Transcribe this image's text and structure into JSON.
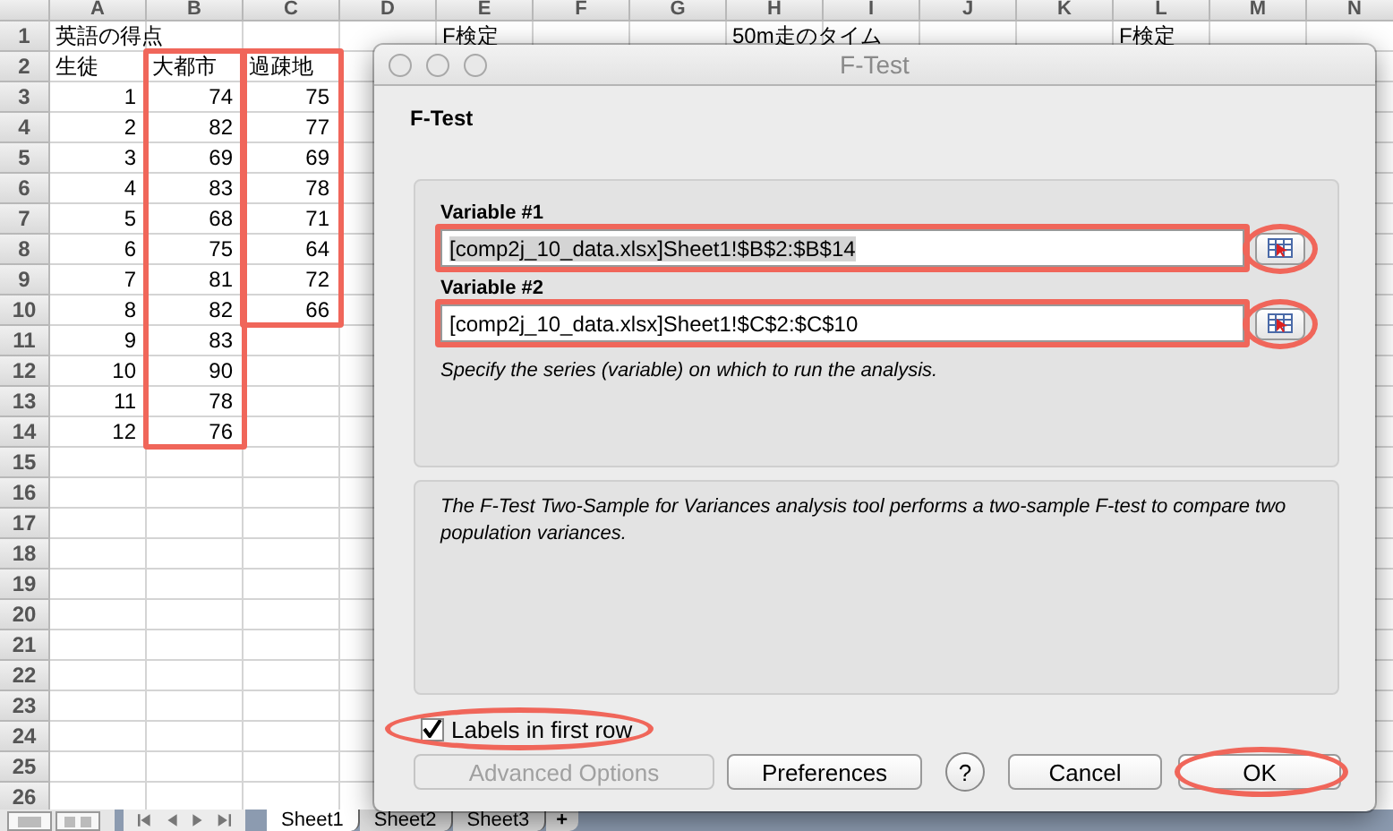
{
  "sheet": {
    "columns": [
      {
        "label": "A",
        "highlighted": false
      },
      {
        "label": "B",
        "highlighted": true
      },
      {
        "label": "C",
        "highlighted": true
      },
      {
        "label": "D",
        "highlighted": false
      },
      {
        "label": "E",
        "highlighted": false
      },
      {
        "label": "F",
        "highlighted": false
      },
      {
        "label": "G",
        "highlighted": false
      },
      {
        "label": "H",
        "highlighted": false
      },
      {
        "label": "I",
        "highlighted": false
      },
      {
        "label": "J",
        "highlighted": false
      },
      {
        "label": "K",
        "highlighted": false
      },
      {
        "label": "L",
        "highlighted": false
      },
      {
        "label": "M",
        "highlighted": false
      },
      {
        "label": "N",
        "highlighted": false
      }
    ],
    "rows": [
      {
        "number": "1",
        "cells": [
          {
            "text": "英語の得点",
            "kind": "text"
          },
          null,
          null,
          null,
          {
            "text": "F検定",
            "kind": "text"
          },
          null,
          null,
          {
            "text": "50m走のタイム",
            "kind": "text"
          },
          null,
          null,
          null,
          {
            "text": "F検定",
            "kind": "text"
          }
        ]
      },
      {
        "number": "2",
        "cells": [
          {
            "text": "生徒",
            "kind": "text"
          },
          {
            "text": "大都市",
            "kind": "text"
          },
          {
            "text": "過疎地",
            "kind": "text"
          }
        ]
      },
      {
        "number": "3",
        "cells": [
          {
            "text": "1",
            "kind": "number"
          },
          {
            "text": "74",
            "kind": "number"
          },
          {
            "text": "75",
            "kind": "number"
          }
        ]
      },
      {
        "number": "4",
        "cells": [
          {
            "text": "2",
            "kind": "number"
          },
          {
            "text": "82",
            "kind": "number"
          },
          {
            "text": "77",
            "kind": "number"
          }
        ]
      },
      {
        "number": "5",
        "cells": [
          {
            "text": "3",
            "kind": "number"
          },
          {
            "text": "69",
            "kind": "number"
          },
          {
            "text": "69",
            "kind": "number"
          }
        ]
      },
      {
        "number": "6",
        "cells": [
          {
            "text": "4",
            "kind": "number"
          },
          {
            "text": "83",
            "kind": "number"
          },
          {
            "text": "78",
            "kind": "number"
          }
        ]
      },
      {
        "number": "7",
        "cells": [
          {
            "text": "5",
            "kind": "number"
          },
          {
            "text": "68",
            "kind": "number"
          },
          {
            "text": "71",
            "kind": "number"
          }
        ]
      },
      {
        "number": "8",
        "cells": [
          {
            "text": "6",
            "kind": "number"
          },
          {
            "text": "75",
            "kind": "number"
          },
          {
            "text": "64",
            "kind": "number"
          }
        ]
      },
      {
        "number": "9",
        "cells": [
          {
            "text": "7",
            "kind": "number"
          },
          {
            "text": "81",
            "kind": "number"
          },
          {
            "text": "72",
            "kind": "number"
          }
        ]
      },
      {
        "number": "10",
        "cells": [
          {
            "text": "8",
            "kind": "number"
          },
          {
            "text": "82",
            "kind": "number"
          },
          {
            "text": "66",
            "kind": "number"
          }
        ]
      },
      {
        "number": "11",
        "cells": [
          {
            "text": "9",
            "kind": "number"
          },
          {
            "text": "83",
            "kind": "number"
          }
        ]
      },
      {
        "number": "12",
        "cells": [
          {
            "text": "10",
            "kind": "number"
          },
          {
            "text": "90",
            "kind": "number"
          }
        ]
      },
      {
        "number": "13",
        "cells": [
          {
            "text": "11",
            "kind": "number"
          },
          {
            "text": "78",
            "kind": "number"
          }
        ]
      },
      {
        "number": "14",
        "cells": [
          {
            "text": "12",
            "kind": "number"
          },
          {
            "text": "76",
            "kind": "number"
          }
        ]
      },
      {
        "number": "15"
      },
      {
        "number": "16"
      },
      {
        "number": "17"
      },
      {
        "number": "18"
      },
      {
        "number": "19"
      },
      {
        "number": "20"
      },
      {
        "number": "21"
      },
      {
        "number": "22"
      },
      {
        "number": "23"
      },
      {
        "number": "24"
      },
      {
        "number": "25"
      },
      {
        "number": "26"
      }
    ]
  },
  "sheet_tabs": [
    {
      "label": "Sheet1",
      "selected": true
    },
    {
      "label": "Sheet2",
      "selected": false
    },
    {
      "label": "Sheet3",
      "selected": false
    }
  ],
  "add_sheet": "+",
  "dialog": {
    "title": "F-Test",
    "heading": "F-Test",
    "variables": [
      {
        "label": "Variable #1",
        "value": "[comp2j_10_data.xlsx]Sheet1!$B$2:$B$14",
        "text_selected": true,
        "highlighted": true
      },
      {
        "label": "Variable #2",
        "value": "[comp2j_10_data.xlsx]Sheet1!$C$2:$C$10",
        "text_selected": false,
        "highlighted": true
      }
    ],
    "hint": "Specify the series (variable) on which to run the analysis.",
    "description": "The F-Test Two-Sample for Variances analysis tool performs a two-sample F-test to compare two population variances.",
    "checkbox": {
      "label": "Labels in first row",
      "checked": true,
      "highlighted": true
    },
    "buttons": [
      {
        "label": "Advanced Options",
        "kind": "push",
        "disabled": true,
        "highlighted": false
      },
      {
        "label": "Preferences",
        "kind": "push",
        "disabled": false,
        "highlighted": false
      },
      {
        "label": "?",
        "kind": "help",
        "disabled": false,
        "highlighted": false
      },
      {
        "label": "Cancel",
        "kind": "push",
        "disabled": false,
        "highlighted": false
      },
      {
        "label": "OK",
        "kind": "push",
        "disabled": false,
        "highlighted": true
      }
    ]
  }
}
